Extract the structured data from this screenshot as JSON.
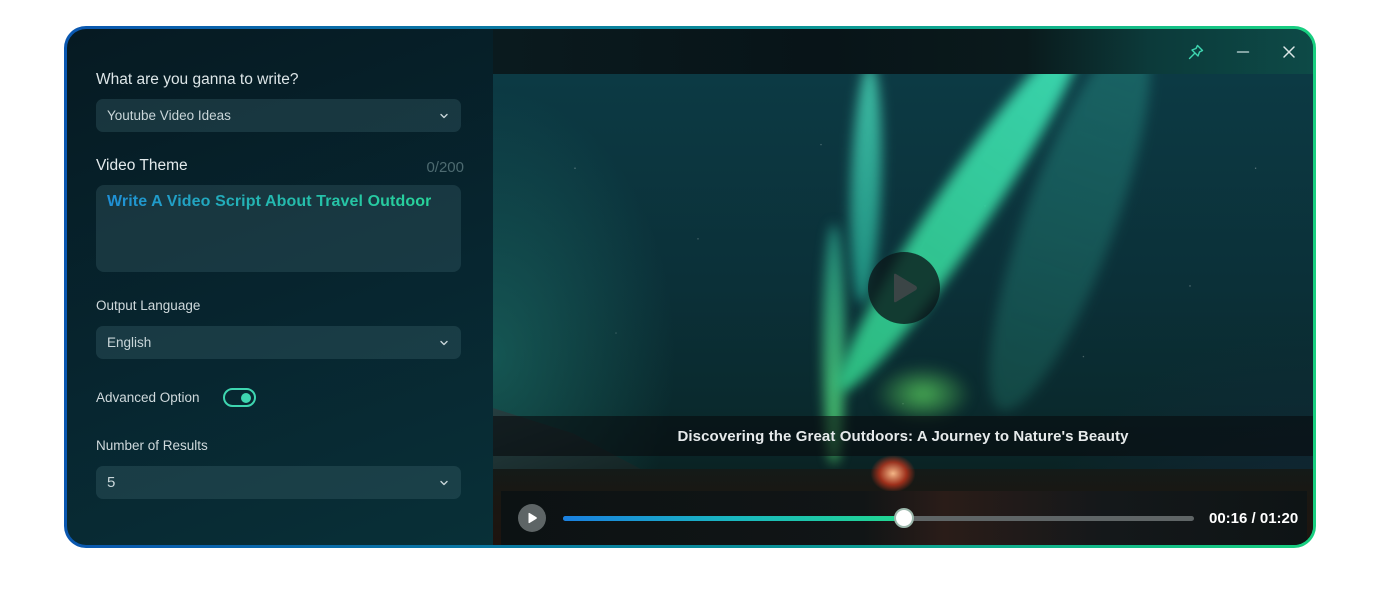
{
  "form": {
    "question_label": "What are you ganna to write?",
    "content_type": {
      "value": "Youtube Video Ideas"
    },
    "theme": {
      "label": "Video Theme",
      "counter": "0/200",
      "value": "Write A Video Script About Travel Outdoor"
    },
    "output_language": {
      "label": "Output Language",
      "value": "English"
    },
    "advanced_option": {
      "label": "Advanced Option",
      "enabled": true
    },
    "number_of_results": {
      "label": "Number of Results",
      "value": "5"
    }
  },
  "titlebar": {
    "icons": [
      "pin-icon",
      "minimize-icon",
      "close-icon"
    ]
  },
  "video": {
    "caption": "Discovering the Great Outdoors: A Journey to Nature's Beauty",
    "current_time": "00:16",
    "duration": "01:20",
    "time_display": "00:16 / 01:20",
    "progress_fraction": 0.54
  },
  "colors": {
    "accent_green": "#3ed6b0",
    "gradient_blue": "#1a80e0",
    "gradient_green": "#22d890"
  }
}
